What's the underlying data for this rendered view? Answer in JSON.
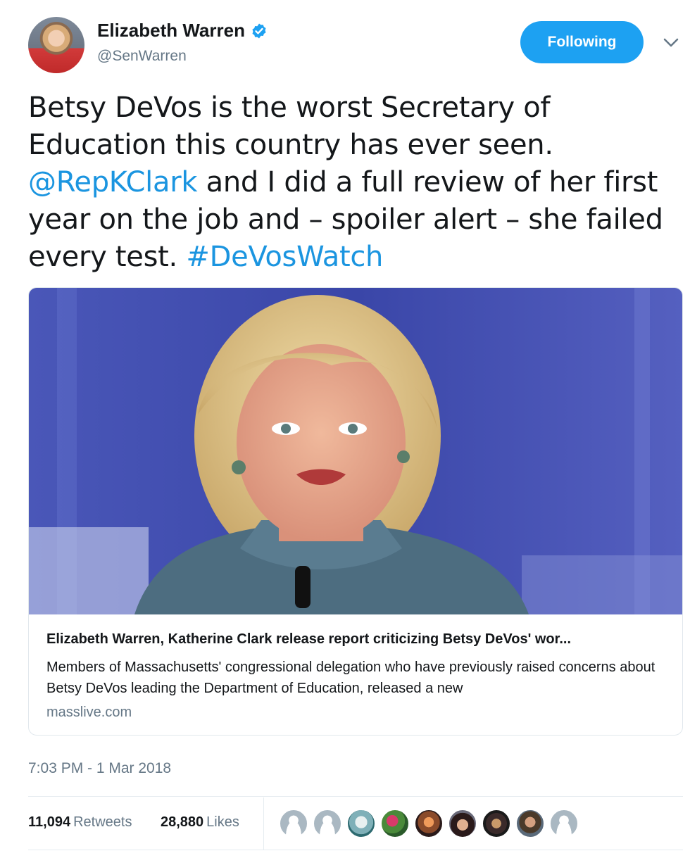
{
  "author": {
    "name": "Elizabeth Warren",
    "handle": "@SenWarren",
    "verified": true
  },
  "follow_button": {
    "label": "Following",
    "color": "#1da1f2"
  },
  "menu": {
    "icon": "chevron-down-icon"
  },
  "tweet": {
    "lines": [
      {
        "text": "Betsy DeVos is the worst Secretary of"
      },
      {
        "text": "Education this country has ever seen."
      },
      {
        "mention": "@RepKClark",
        "text": " and I did a full review of her first"
      },
      {
        "text": "year on the job and – spoiler alert – she failed"
      },
      {
        "text": "every test. ",
        "hashtag": "#DeVosWatch"
      }
    ],
    "link_color": "#1b95e0"
  },
  "card": {
    "title": "Elizabeth Warren, Katherine Clark release report criticizing Betsy DeVos' wor...",
    "description": "Members of Massachusetts' congressional delegation who have previously raised concerns about Betsy DeVos leading the Department of Education, released a new",
    "domain": "masslive.com"
  },
  "timestamp": "7:03 PM - 1 Mar 2018",
  "stats": {
    "retweets_count": "11,094",
    "retweets_label": "Retweets",
    "likes_count": "28,880",
    "likes_label": "Likes"
  },
  "likers_count": 9
}
